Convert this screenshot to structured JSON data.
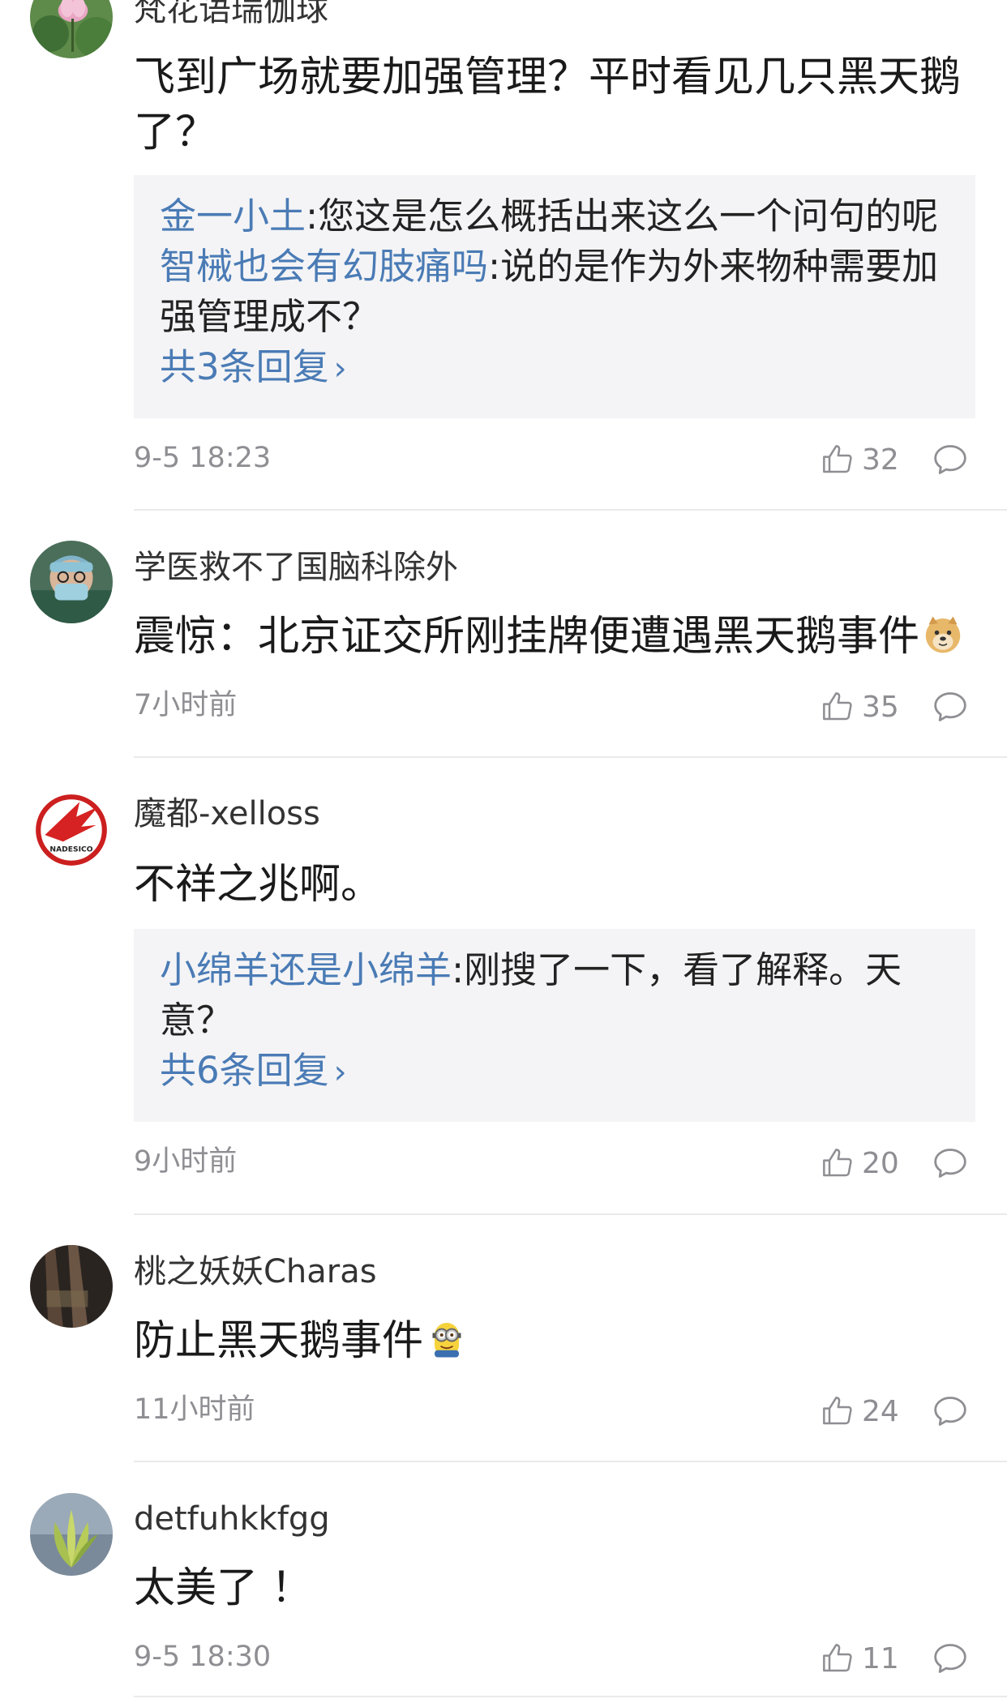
{
  "comments": [
    {
      "username": "梵花语瑞伽球",
      "content": "飞到广场就要加强管理？平时看见几只黑天鹅了？",
      "replies": [
        {
          "name": "金一小土",
          "text": ":您这是怎么概括出来这么一个问句的呢"
        },
        {
          "name": "智械也会有幻肢痛吗",
          "text": ":说的是作为外来物种需要加强管理成不？"
        }
      ],
      "more_replies": "共3条回复",
      "time": "9-5 18:23",
      "likes": "32"
    },
    {
      "username": "学医救不了国脑科除外",
      "content": "震惊：北京证交所刚挂牌便遭遇黑天鹅事件",
      "emoji": "doge-emoji",
      "time": "7小时前",
      "likes": "35"
    },
    {
      "username": "魔都-xelloss",
      "content": "不祥之兆啊。",
      "avatar_text": "NADESICO",
      "replies": [
        {
          "name": "小绵羊还是小绵羊",
          "text": ":刚搜了一下，看了解释。天意？"
        }
      ],
      "more_replies": "共6条回复",
      "time": "9小时前",
      "likes": "20"
    },
    {
      "username": "桃之妖妖Charas",
      "content": "防止黑天鹅事件",
      "emoji": "minion-emoji",
      "time": "11小时前",
      "likes": "24"
    },
    {
      "username": "detfuhkkfgg",
      "content": "太美了 ！",
      "time": "9-5 18:30",
      "likes": "11"
    }
  ],
  "colors": {
    "reply_name": "#4a7bb5",
    "meta_gray": "#8e8e93",
    "reply_bg": "#f4f4f6"
  },
  "icons": [
    "like-icon",
    "reply-icon",
    "chevron-right-icon"
  ]
}
